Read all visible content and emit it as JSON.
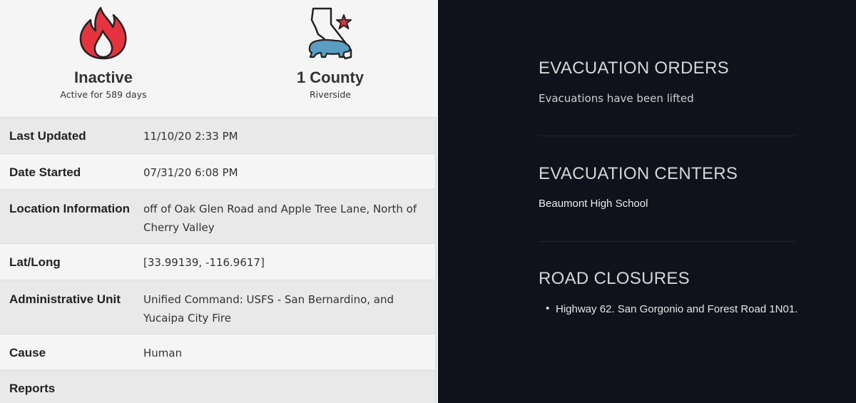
{
  "status": {
    "icon": "fire-icon",
    "state": "Inactive",
    "active_text": "Active for 589 days"
  },
  "counties": {
    "icon": "california-bear-icon",
    "count_text": "1 County",
    "names": "Riverside"
  },
  "details": [
    {
      "label": "Last Updated",
      "value": "11/10/20 2:33 PM"
    },
    {
      "label": "Date Started",
      "value": "07/31/20 6:08 PM"
    },
    {
      "label": "Location Information",
      "value": "off of Oak Glen Road and Apple Tree Lane, North of Cherry Valley"
    },
    {
      "label": "Lat/Long",
      "value": "[33.99139, -116.9617]"
    },
    {
      "label": "Administrative Unit",
      "value": "Unified Command: USFS - San Bernardino, and Yucaipa City Fire"
    },
    {
      "label": "Cause",
      "value": "Human"
    },
    {
      "label": "Reports",
      "value": ""
    }
  ],
  "evacuation_orders": {
    "heading": "EVACUATION ORDERS",
    "text": "Evacuations have been lifted"
  },
  "evacuation_centers": {
    "heading": "EVACUATION CENTERS",
    "text": "Beaumont High School"
  },
  "road_closures": {
    "heading": "ROAD CLOSURES",
    "items": [
      "Highway 62. San Gorgonio and Forest Road 1N01."
    ]
  },
  "colors": {
    "fire_red": "#e5343e",
    "bear_blue": "#5a9ec4",
    "star_red": "#e5343e",
    "dark_panel": "#0f121a"
  }
}
